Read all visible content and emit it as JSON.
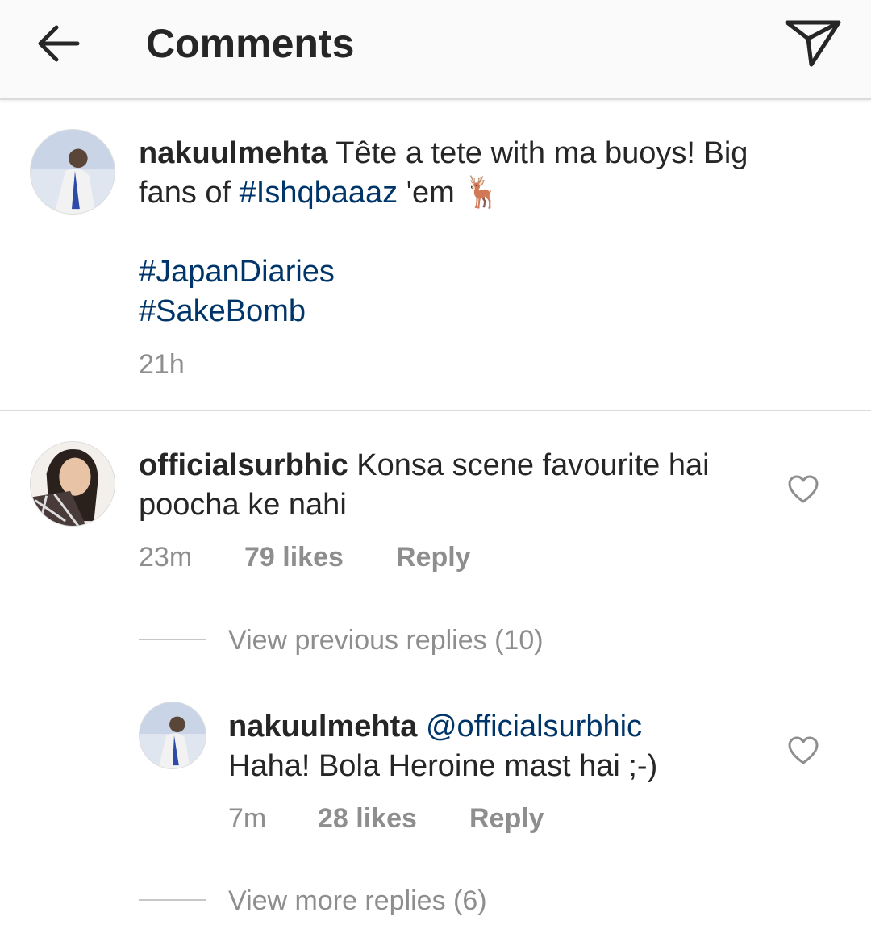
{
  "header": {
    "title": "Comments",
    "back_icon": "arrow-left-icon",
    "send_icon": "paper-plane-icon"
  },
  "caption": {
    "username": "nakuulmehta",
    "line1_text": " Tête a tete with ma buoys! Big",
    "line2_prefix": "fans of ",
    "line2_tag": "#Ishqbaaaz",
    "line2_suffix": " 'em ",
    "emoji": "🦌",
    "tag1": "#JapanDiaries",
    "tag2": "#SakeBomb",
    "time": "21h"
  },
  "comments": [
    {
      "username": "officialsurbhic",
      "line1": " Konsa scene favourite hai",
      "line2": "poocha ke nahi",
      "time": "23m",
      "likes": "79 likes",
      "reply_label": "Reply",
      "heart_icon": "heart-outline-icon"
    }
  ],
  "view_previous": "View previous replies (10)",
  "reply": {
    "username": "nakuulmehta",
    "mention": " @officialsurbhic",
    "line2": "Haha! Bola Heroine mast hai ;-)",
    "time": "7m",
    "likes": "28 likes",
    "reply_label": "Reply",
    "heart_icon": "heart-outline-icon"
  },
  "view_more": "View more replies (6)",
  "colors": {
    "hashtag": "#003569",
    "text": "#262626",
    "meta": "#8e8e8e",
    "header_bg": "#fafafa"
  }
}
